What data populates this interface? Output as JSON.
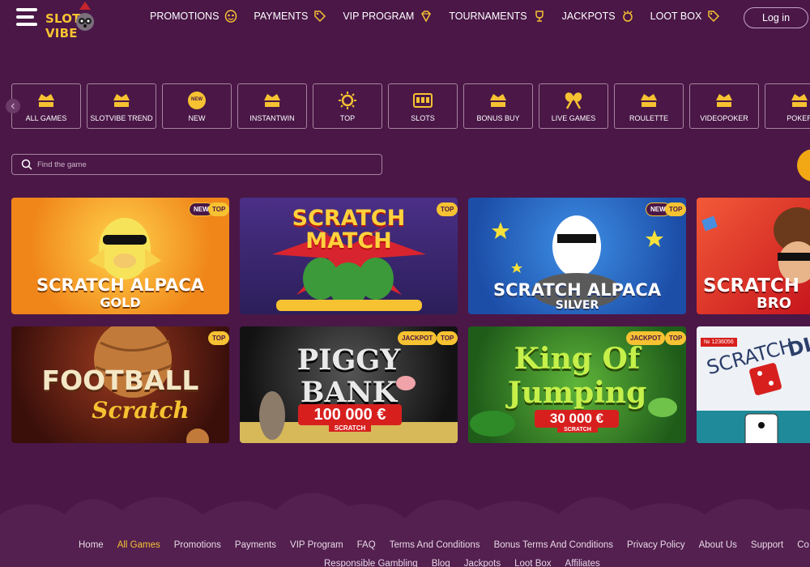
{
  "header": {
    "logo": {
      "part1": "SLOT",
      "part2": "VIBE"
    },
    "nav": [
      {
        "label": "PROMOTIONS",
        "icon": "mask-icon"
      },
      {
        "label": "PAYMENTS",
        "icon": "tag-icon"
      },
      {
        "label": "VIP PROGRAM",
        "icon": "gem-icon"
      },
      {
        "label": "TOURNAMENTS",
        "icon": "trophy-icon"
      },
      {
        "label": "JACKPOTS",
        "icon": "jackpot-icon"
      },
      {
        "label": "LOOT BOX",
        "icon": "tag-icon"
      }
    ],
    "login_label": "Log in"
  },
  "categories": [
    {
      "label": "ALL GAMES",
      "icon": "cards-icon"
    },
    {
      "label": "SLOTVIBE TREND",
      "icon": "cards-icon"
    },
    {
      "label": "NEW",
      "icon": "new-badge-icon"
    },
    {
      "label": "INSTANTWIN",
      "icon": "cards-icon"
    },
    {
      "label": "TOP",
      "icon": "sun-icon"
    },
    {
      "label": "SLOTS",
      "icon": "slot-machine-icon"
    },
    {
      "label": "BONUS BUY",
      "icon": "cards-icon"
    },
    {
      "label": "LIVE GAMES",
      "icon": "maracas-icon"
    },
    {
      "label": "ROULETTE",
      "icon": "cards-icon"
    },
    {
      "label": "VIDEOPOKER",
      "icon": "cards-icon"
    },
    {
      "label": "POKER",
      "icon": "cards-icon"
    }
  ],
  "new_icon_text": "NEW",
  "search": {
    "placeholder": "Find the game"
  },
  "games": [
    {
      "title_line1": "SCRATCH ALPACA",
      "title_line2": "GOLD",
      "badges": [
        "NEW",
        "TOP"
      ],
      "bg": "#f49a16"
    },
    {
      "title_line1": "SCRATCH",
      "title_line2": "MATCH",
      "badges": [
        "TOP"
      ],
      "bg": "#3b2a7a"
    },
    {
      "title_line1": "SCRATCH ALPACA",
      "title_line2": "SILVER",
      "badges": [
        "NEW",
        "TOP"
      ],
      "bg": "#2d7ad4"
    },
    {
      "title_line1": "SCRATCH",
      "title_line2": "BRO",
      "badges": [],
      "bg": "#e0332b"
    },
    {
      "title_line1": "FOOTBALL",
      "title_line2": "Scratch",
      "badges": [
        "TOP"
      ],
      "bg": "#6a2413"
    },
    {
      "title_line1": "PIGGY",
      "title_line2": "BANK",
      "prize": "100 000 €",
      "sub": "SCRATCH",
      "badges": [
        "JACKPOT",
        "TOP"
      ],
      "bg": "#2a2a2a"
    },
    {
      "title_line1": "King Of",
      "title_line2": "Jumping",
      "prize": "30 000 €",
      "sub": "SCRATCH",
      "badges": [
        "JACKPOT",
        "TOP"
      ],
      "bg": "#2f8a28"
    },
    {
      "title_line1": "SCRATCH",
      "title_line2": "DI",
      "ticket": "№ 1236056",
      "badges": [],
      "bg": "#e9eef3"
    }
  ],
  "footer": {
    "links_row1": [
      "Home",
      "All Games",
      "Promotions",
      "Payments",
      "VIP Program",
      "FAQ",
      "Terms And Conditions",
      "Bonus Terms And Conditions",
      "Privacy Policy",
      "About Us",
      "Support",
      "Co"
    ],
    "active_link": "All Games",
    "links_row2": [
      "Responsible Gambling",
      "Blog",
      "Jackpots",
      "Loot Box",
      "Affiliates"
    ]
  },
  "colors": {
    "background": "#4a1747",
    "accent": "#f6c232",
    "border": "#a8849f"
  }
}
